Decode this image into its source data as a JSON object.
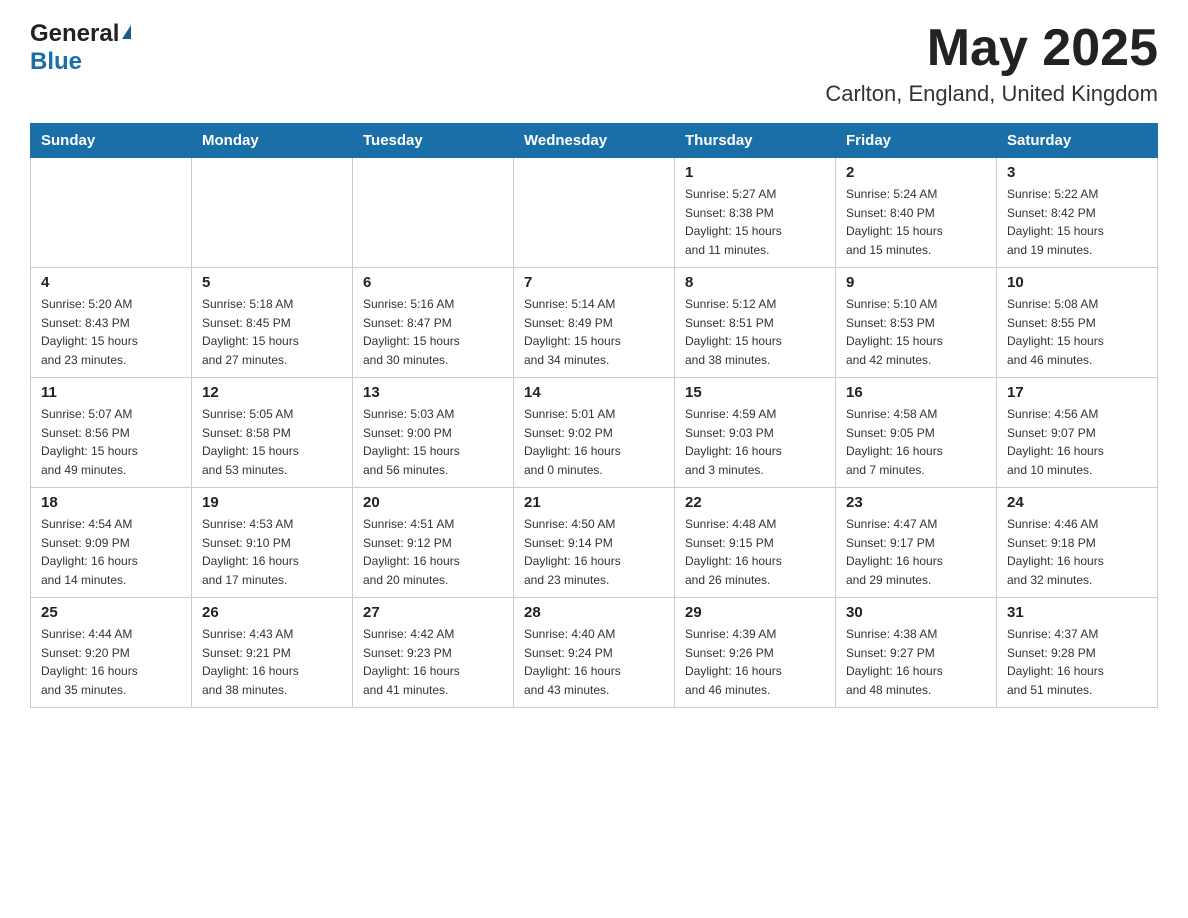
{
  "header": {
    "logo_general": "General",
    "logo_blue": "Blue",
    "month_title": "May 2025",
    "location": "Carlton, England, United Kingdom"
  },
  "days_of_week": [
    "Sunday",
    "Monday",
    "Tuesday",
    "Wednesday",
    "Thursday",
    "Friday",
    "Saturday"
  ],
  "weeks": [
    [
      {
        "day": "",
        "info": ""
      },
      {
        "day": "",
        "info": ""
      },
      {
        "day": "",
        "info": ""
      },
      {
        "day": "",
        "info": ""
      },
      {
        "day": "1",
        "info": "Sunrise: 5:27 AM\nSunset: 8:38 PM\nDaylight: 15 hours\nand 11 minutes."
      },
      {
        "day": "2",
        "info": "Sunrise: 5:24 AM\nSunset: 8:40 PM\nDaylight: 15 hours\nand 15 minutes."
      },
      {
        "day": "3",
        "info": "Sunrise: 5:22 AM\nSunset: 8:42 PM\nDaylight: 15 hours\nand 19 minutes."
      }
    ],
    [
      {
        "day": "4",
        "info": "Sunrise: 5:20 AM\nSunset: 8:43 PM\nDaylight: 15 hours\nand 23 minutes."
      },
      {
        "day": "5",
        "info": "Sunrise: 5:18 AM\nSunset: 8:45 PM\nDaylight: 15 hours\nand 27 minutes."
      },
      {
        "day": "6",
        "info": "Sunrise: 5:16 AM\nSunset: 8:47 PM\nDaylight: 15 hours\nand 30 minutes."
      },
      {
        "day": "7",
        "info": "Sunrise: 5:14 AM\nSunset: 8:49 PM\nDaylight: 15 hours\nand 34 minutes."
      },
      {
        "day": "8",
        "info": "Sunrise: 5:12 AM\nSunset: 8:51 PM\nDaylight: 15 hours\nand 38 minutes."
      },
      {
        "day": "9",
        "info": "Sunrise: 5:10 AM\nSunset: 8:53 PM\nDaylight: 15 hours\nand 42 minutes."
      },
      {
        "day": "10",
        "info": "Sunrise: 5:08 AM\nSunset: 8:55 PM\nDaylight: 15 hours\nand 46 minutes."
      }
    ],
    [
      {
        "day": "11",
        "info": "Sunrise: 5:07 AM\nSunset: 8:56 PM\nDaylight: 15 hours\nand 49 minutes."
      },
      {
        "day": "12",
        "info": "Sunrise: 5:05 AM\nSunset: 8:58 PM\nDaylight: 15 hours\nand 53 minutes."
      },
      {
        "day": "13",
        "info": "Sunrise: 5:03 AM\nSunset: 9:00 PM\nDaylight: 15 hours\nand 56 minutes."
      },
      {
        "day": "14",
        "info": "Sunrise: 5:01 AM\nSunset: 9:02 PM\nDaylight: 16 hours\nand 0 minutes."
      },
      {
        "day": "15",
        "info": "Sunrise: 4:59 AM\nSunset: 9:03 PM\nDaylight: 16 hours\nand 3 minutes."
      },
      {
        "day": "16",
        "info": "Sunrise: 4:58 AM\nSunset: 9:05 PM\nDaylight: 16 hours\nand 7 minutes."
      },
      {
        "day": "17",
        "info": "Sunrise: 4:56 AM\nSunset: 9:07 PM\nDaylight: 16 hours\nand 10 minutes."
      }
    ],
    [
      {
        "day": "18",
        "info": "Sunrise: 4:54 AM\nSunset: 9:09 PM\nDaylight: 16 hours\nand 14 minutes."
      },
      {
        "day": "19",
        "info": "Sunrise: 4:53 AM\nSunset: 9:10 PM\nDaylight: 16 hours\nand 17 minutes."
      },
      {
        "day": "20",
        "info": "Sunrise: 4:51 AM\nSunset: 9:12 PM\nDaylight: 16 hours\nand 20 minutes."
      },
      {
        "day": "21",
        "info": "Sunrise: 4:50 AM\nSunset: 9:14 PM\nDaylight: 16 hours\nand 23 minutes."
      },
      {
        "day": "22",
        "info": "Sunrise: 4:48 AM\nSunset: 9:15 PM\nDaylight: 16 hours\nand 26 minutes."
      },
      {
        "day": "23",
        "info": "Sunrise: 4:47 AM\nSunset: 9:17 PM\nDaylight: 16 hours\nand 29 minutes."
      },
      {
        "day": "24",
        "info": "Sunrise: 4:46 AM\nSunset: 9:18 PM\nDaylight: 16 hours\nand 32 minutes."
      }
    ],
    [
      {
        "day": "25",
        "info": "Sunrise: 4:44 AM\nSunset: 9:20 PM\nDaylight: 16 hours\nand 35 minutes."
      },
      {
        "day": "26",
        "info": "Sunrise: 4:43 AM\nSunset: 9:21 PM\nDaylight: 16 hours\nand 38 minutes."
      },
      {
        "day": "27",
        "info": "Sunrise: 4:42 AM\nSunset: 9:23 PM\nDaylight: 16 hours\nand 41 minutes."
      },
      {
        "day": "28",
        "info": "Sunrise: 4:40 AM\nSunset: 9:24 PM\nDaylight: 16 hours\nand 43 minutes."
      },
      {
        "day": "29",
        "info": "Sunrise: 4:39 AM\nSunset: 9:26 PM\nDaylight: 16 hours\nand 46 minutes."
      },
      {
        "day": "30",
        "info": "Sunrise: 4:38 AM\nSunset: 9:27 PM\nDaylight: 16 hours\nand 48 minutes."
      },
      {
        "day": "31",
        "info": "Sunrise: 4:37 AM\nSunset: 9:28 PM\nDaylight: 16 hours\nand 51 minutes."
      }
    ]
  ]
}
